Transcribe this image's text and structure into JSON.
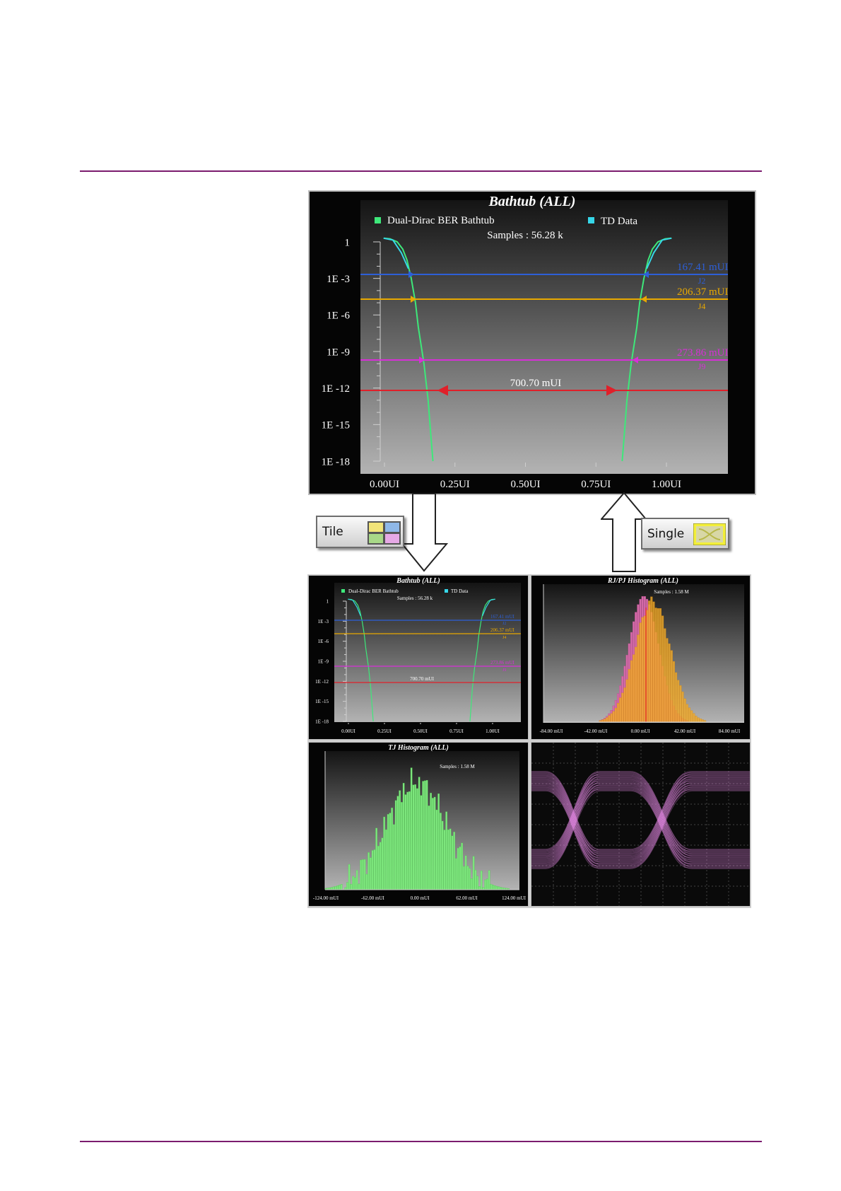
{
  "big_bathtub": {
    "title": "Bathtub (ALL)",
    "legend": [
      "Dual-Dirac BER Bathtub",
      "TD Data"
    ],
    "samples": "Samples : 56.28 k",
    "y_ticks": [
      "1",
      "1E -3",
      "1E -6",
      "1E -9",
      "1E -12",
      "1E -15",
      "1E -18"
    ],
    "x_ticks": [
      "0.00UI",
      "0.25UI",
      "0.50UI",
      "0.75UI",
      "1.00UI"
    ],
    "j2_value": "167.41 mUI",
    "j2_label": "J2",
    "j4_value": "206.37 mUI",
    "j4_label": "J4",
    "j9_value": "273.86 mUI",
    "j9_label": "J9",
    "eye_width": "700.70 mUI"
  },
  "colors": {
    "rule": "#7b1b6e",
    "curve": "#3ee87a",
    "td": "#36d6e8",
    "j2": "#2d5fd8",
    "j4": "#e8a800",
    "j9": "#d82fd8",
    "opening": "#e0202a"
  },
  "buttons": {
    "tile_label": "Tile",
    "single_label": "Single"
  },
  "tiles": {
    "bathtub": {
      "title": "Bathtub (ALL)",
      "legend": [
        "Dual-Dirac BER Bathtub",
        "TD Data"
      ],
      "samples": "Samples : 56.28 k",
      "y_ticks": [
        "1",
        "1E -3",
        "1E -6",
        "1E -9",
        "1E -12",
        "1E -15",
        "1E -18"
      ],
      "x_ticks": [
        "0.00UI",
        "0.25UI",
        "0.50UI",
        "0.75UI",
        "1.00UI"
      ],
      "j2_value": "167.41 mUI",
      "j2_label": "J2",
      "j4_value": "206.37 mUI",
      "j4_label": "J4",
      "j9_value": "273.86 mUI",
      "j9_label": "J9",
      "eye_width": "700.70 mUI"
    },
    "rjpj": {
      "title": "RJ/PJ Histogram (ALL)",
      "samples": "Samples : 1.58 M",
      "x_ticks": [
        "-84.00 mUI",
        "-42.00 mUI",
        "0.00 mUI",
        "42.00 mUI",
        "84.00 mUI"
      ]
    },
    "tj": {
      "title": "TJ Histogram (ALL)",
      "samples": "Samples : 1.58 M",
      "x_ticks": [
        "-124.00 mUI",
        "-62.00 mUI",
        "0.00 mUI",
        "62.00 mUI",
        "124.00 mUI"
      ]
    }
  },
  "chart_data": [
    {
      "type": "line",
      "title": "Bathtub (ALL)",
      "series": [
        {
          "name": "Dual-Dirac BER Bathtub"
        },
        {
          "name": "TD Data"
        }
      ],
      "x_unit": "UI",
      "xlim": [
        0,
        1
      ],
      "y_scale": "log",
      "ylim": [
        1e-18,
        1
      ],
      "markers": [
        {
          "label": "J2",
          "ber": 0.001,
          "value": "167.41 mUI"
        },
        {
          "label": "J4",
          "ber": 1e-05,
          "value": "206.37 mUI"
        },
        {
          "label": "J9",
          "ber": 1e-10,
          "value": "273.86 mUI"
        },
        {
          "ber": 1e-12,
          "value": "700.70 mUI"
        }
      ]
    },
    {
      "type": "bar",
      "title": "RJ/PJ Histogram (ALL)",
      "samples": "1.58 M",
      "xlim": [
        -84,
        84
      ],
      "x_unit": "mUI"
    },
    {
      "type": "bar",
      "title": "TJ Histogram (ALL)",
      "samples": "1.58 M",
      "xlim": [
        -124,
        124
      ],
      "x_unit": "mUI"
    }
  ]
}
